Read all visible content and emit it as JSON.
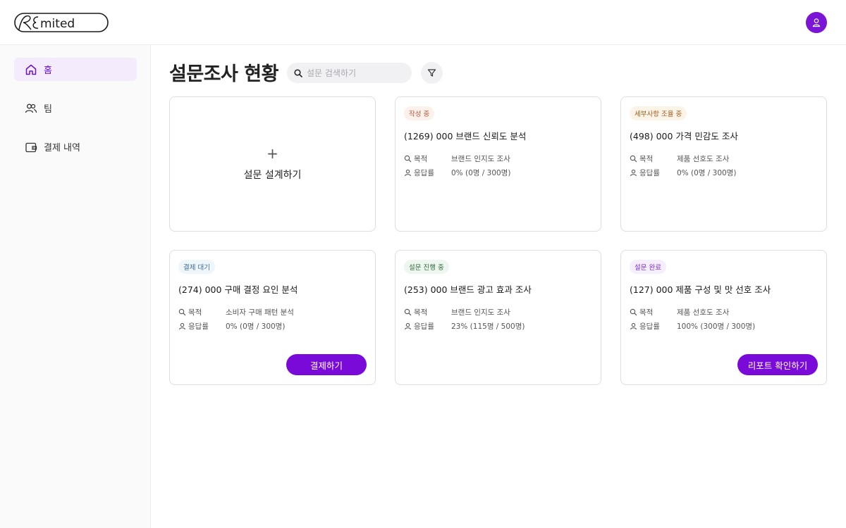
{
  "header": {
    "logo_text": "Remited"
  },
  "sidebar": {
    "items": [
      {
        "label": "홈"
      },
      {
        "label": "팀"
      },
      {
        "label": "결제 내역"
      }
    ]
  },
  "main": {
    "title": "설문조사 현황",
    "search_placeholder": "설문 검색하기",
    "new_card_label": "설문 설계하기",
    "new_card_plus": "+"
  },
  "labels": {
    "purpose": "목적",
    "response": "응답률"
  },
  "cards": [
    {
      "status": "작성 중",
      "title": "(1269) 000 브랜드 신뢰도 분석",
      "purpose": "브랜드 인지도 조사",
      "response": "0% (0명 / 300명)"
    },
    {
      "status": "세부사항 조율 중",
      "title": "(498) 000 가격 민감도 조사",
      "purpose": "제품 선호도 조사",
      "response": "0% (0명 / 300명)"
    },
    {
      "status": "결제 대기",
      "title": "(274) 000 구매 결정 요인 분석",
      "purpose": "소비자 구매 패턴 분석",
      "response": "0% (0명 / 300명)",
      "action": "결제하기"
    },
    {
      "status": "설문 진행 중",
      "title": "(253) 000 브랜드 광고 효과 조사",
      "purpose": "브랜드 인지도 조사",
      "response": "23% (115명 / 500명)"
    },
    {
      "status": "설문 완료",
      "title": "(127) 000 제품 구성 및 맛 선호 조사",
      "purpose": "제품 선호도 조사",
      "response": "100% (300명 / 300명)",
      "action": "리포트 확인하기"
    }
  ],
  "colors": {
    "accent": "#7a0ad8",
    "active_nav_bg": "#f4ecfd"
  }
}
